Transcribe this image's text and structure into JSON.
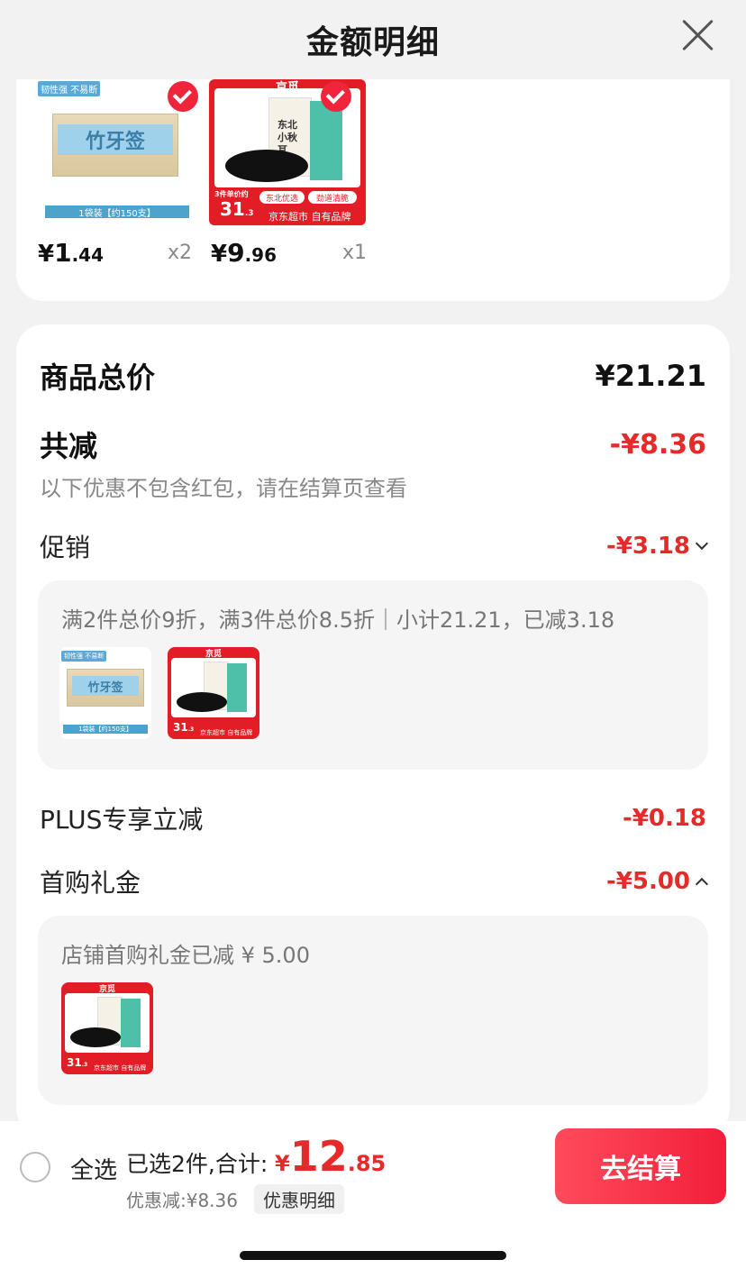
{
  "header": {
    "title": "金额明细"
  },
  "products": [
    {
      "name": "toothpick",
      "tag": "韧性强 不易断",
      "brand_text": "竹牙签",
      "bar_text": "1袋装【约150支】",
      "price_symbol": "¥",
      "price_int": "1",
      "price_dec": ".44",
      "qty": "x2"
    },
    {
      "name": "black-fungus",
      "brand": "京觅",
      "bag_text": "东北小秋耳",
      "unit_label": "3件单价约",
      "unit_price": "31",
      "unit_price_dec": ".3",
      "pill1": "东北优选",
      "pill2": "劲道清脆",
      "footer": "京东超市 自有品牌",
      "price_symbol": "¥",
      "price_int": "9",
      "price_dec": ".96",
      "qty": "x1"
    }
  ],
  "summary": {
    "goods_total_label": "商品总价",
    "goods_total_value": "¥21.21",
    "reduction_label": "共减",
    "reduction_value": "-¥8.36",
    "reduction_note": "以下优惠不包含红包，请在结算页查看",
    "promo_label": "促销",
    "promo_value": "-¥3.18",
    "promo_detail": "满2件总价9折，满3件总价8.5折｜小计21.21，已减3.18",
    "plus_label": "PLUS专享立减",
    "plus_value": "-¥0.18",
    "gift_label": "首购礼金",
    "gift_value": "-¥5.00",
    "gift_detail": "店铺首购礼金已减 ¥ 5.00"
  },
  "bottom": {
    "select_all": "全选",
    "selected_text": "已选2件,合计:",
    "total_symbol": "¥",
    "total_int": "12",
    "total_dec": ".85",
    "discount_text": "优惠减:¥8.36",
    "discount_chip": "优惠明细",
    "checkout": "去结算"
  },
  "colors": {
    "accent_red": "#e62a2a",
    "button_red": "#f21f3b"
  }
}
